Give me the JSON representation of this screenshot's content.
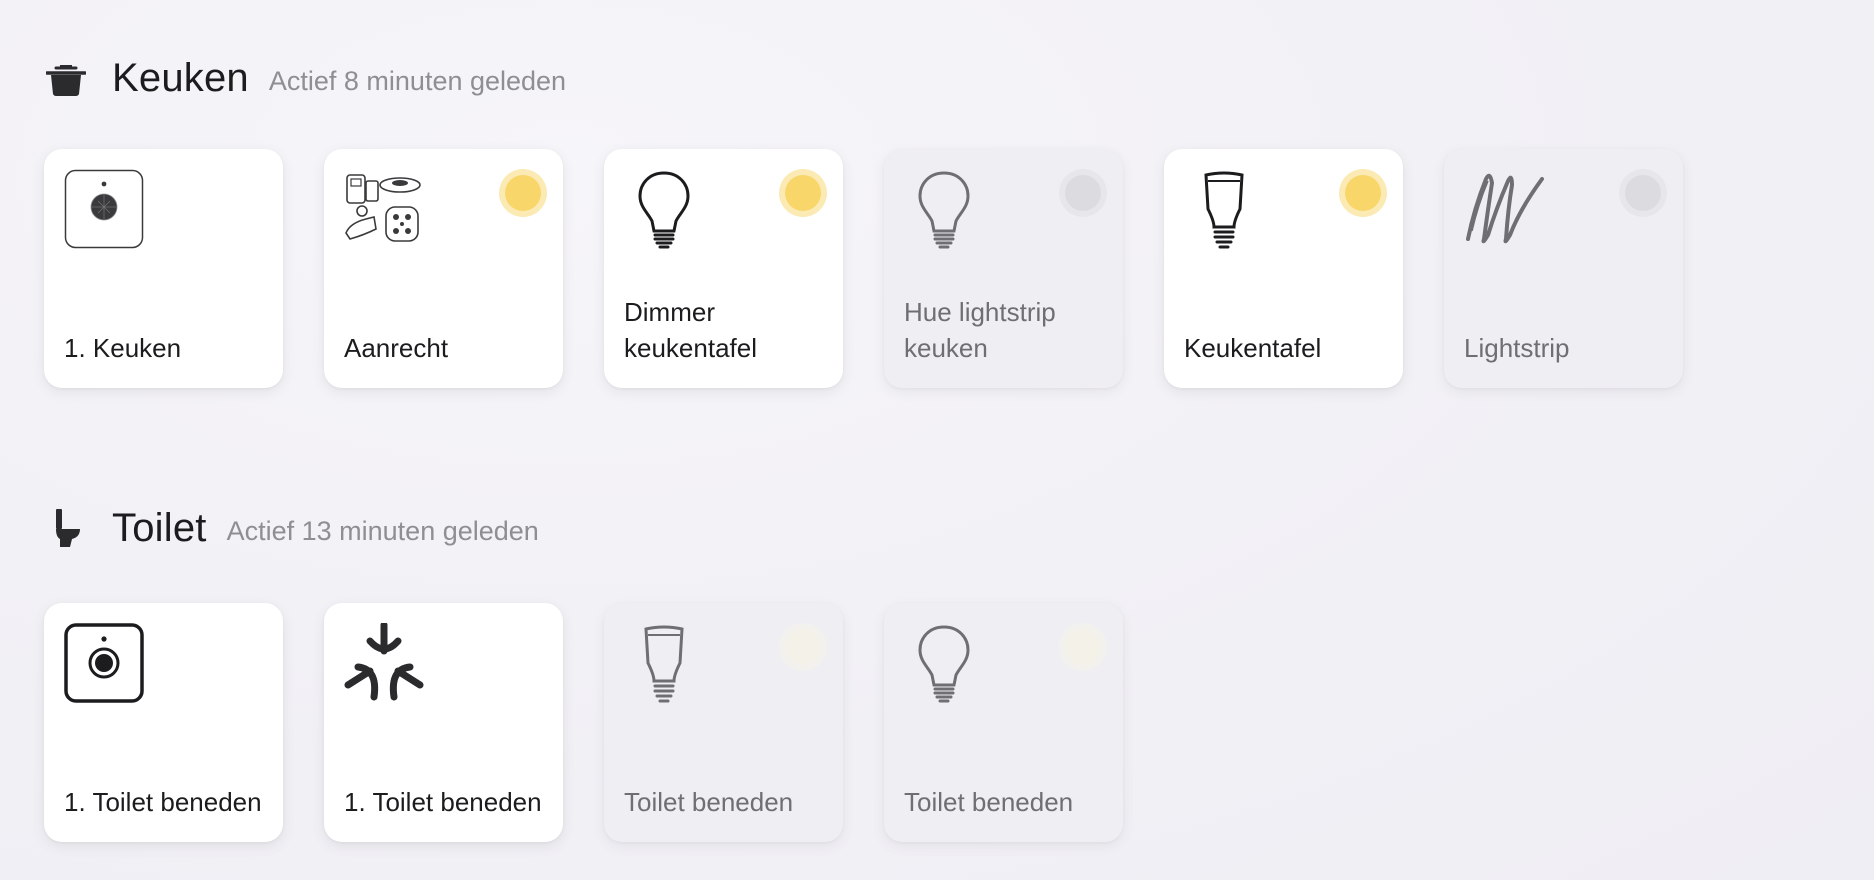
{
  "rooms": [
    {
      "name": "Keuken",
      "status": "Actief 8 minuten geleden",
      "icon": "cooking-pot-icon",
      "tiles": [
        {
          "label": "1. Keuken",
          "icon": "motion-sensor-icon",
          "state": "none"
        },
        {
          "label": "Aanrecht",
          "icon": "dimmer-kit-icon",
          "state": "on"
        },
        {
          "label": "Dimmer keukentafel",
          "icon": "bulb-icon",
          "state": "on"
        },
        {
          "label": "Hue lightstrip keuken",
          "icon": "bulb-icon",
          "state": "off"
        },
        {
          "label": "Keukentafel",
          "icon": "spot-bulb-icon",
          "state": "on"
        },
        {
          "label": "Lightstrip",
          "icon": "lightstrip-icon",
          "state": "off"
        }
      ]
    },
    {
      "name": "Toilet",
      "status": "Actief 13 minuten geleden",
      "icon": "toilet-icon",
      "tiles": [
        {
          "label": "1. Toilet beneden",
          "icon": "motion-sensor-icon",
          "state": "none"
        },
        {
          "label": "1. Toilet beneden",
          "icon": "matter-icon",
          "state": "none"
        },
        {
          "label": "Toilet beneden",
          "icon": "spot-bulb-icon",
          "state": "unreachable"
        },
        {
          "label": "Toilet beneden",
          "icon": "bulb-icon",
          "state": "unreachable"
        }
      ]
    }
  ],
  "colors": {
    "on": "#f9d66a",
    "off": "#dcdce0",
    "tile_on_bg": "#ffffff",
    "tile_off_bg": "#efeef3"
  }
}
